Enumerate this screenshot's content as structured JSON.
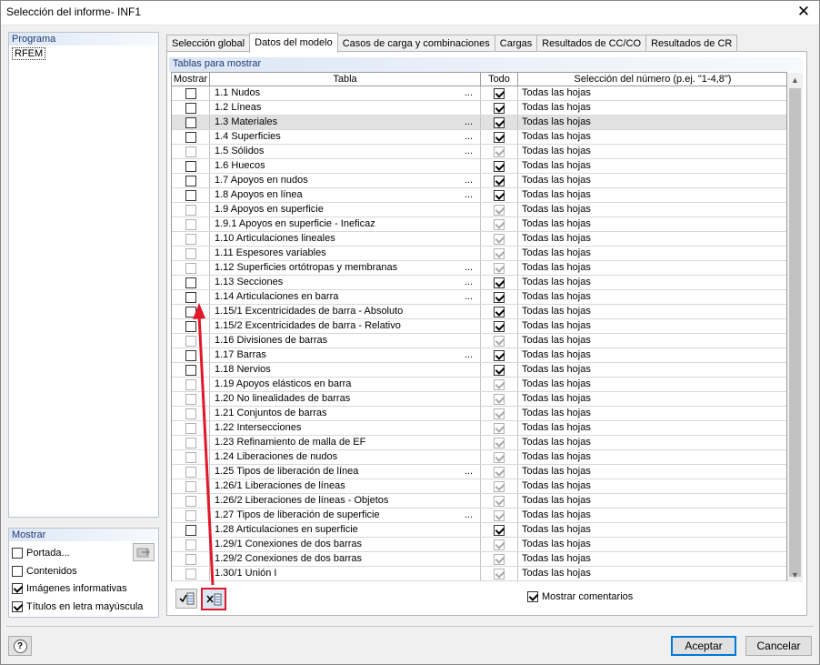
{
  "window": {
    "title": "Selección del informe- INF1",
    "close_glyph": "✕"
  },
  "programa": {
    "heading": "Programa",
    "item": "RFEM"
  },
  "mostrar": {
    "heading": "Mostrar",
    "options": [
      {
        "label": "Portada...",
        "checked": false
      },
      {
        "label": "Contenidos",
        "checked": false
      },
      {
        "label": "Imágenes informativas",
        "checked": true
      },
      {
        "label": "Títulos en letra mayúscula",
        "checked": true
      }
    ]
  },
  "tabs": [
    "Selección global",
    "Datos del modelo",
    "Casos de carga y combinaciones",
    "Cargas",
    "Resultados de CC/CO",
    "Resultados de CR"
  ],
  "active_tab": 1,
  "group": {
    "heading": "Tablas para mostrar"
  },
  "table": {
    "columns": [
      "Mostrar",
      "Tabla",
      "Todo",
      "Selección del número (p.ej. \"1-4,8\")"
    ],
    "rows": [
      {
        "name": "1.1 Nudos",
        "dots": true,
        "enabled": true,
        "selection": "Todas las hojas"
      },
      {
        "name": "1.2 Líneas",
        "dots": false,
        "enabled": true,
        "selection": "Todas las hojas"
      },
      {
        "name": "1.3 Materiales",
        "dots": true,
        "enabled": true,
        "selection": "Todas las hojas",
        "highlight": true
      },
      {
        "name": "1.4 Superficies",
        "dots": true,
        "enabled": true,
        "selection": "Todas las hojas"
      },
      {
        "name": "1.5 Sólidos",
        "dots": true,
        "enabled": false,
        "selection": "Todas las hojas"
      },
      {
        "name": "1.6 Huecos",
        "dots": false,
        "enabled": true,
        "selection": "Todas las hojas"
      },
      {
        "name": "1.7 Apoyos en nudos",
        "dots": true,
        "enabled": true,
        "selection": "Todas las hojas"
      },
      {
        "name": "1.8 Apoyos en línea",
        "dots": true,
        "enabled": true,
        "selection": "Todas las hojas"
      },
      {
        "name": "1.9 Apoyos en superficie",
        "dots": false,
        "enabled": false,
        "selection": "Todas las hojas"
      },
      {
        "name": "1.9.1 Apoyos en superficie - Ineficaz",
        "dots": false,
        "enabled": false,
        "selection": "Todas las hojas"
      },
      {
        "name": "1.10 Articulaciones lineales",
        "dots": false,
        "enabled": false,
        "selection": "Todas las hojas"
      },
      {
        "name": "1.11 Espesores variables",
        "dots": false,
        "enabled": false,
        "selection": "Todas las hojas"
      },
      {
        "name": "1.12 Superficies ortótropas y membranas",
        "dots": true,
        "enabled": false,
        "selection": "Todas las hojas"
      },
      {
        "name": "1.13 Secciones",
        "dots": true,
        "enabled": true,
        "selection": "Todas las hojas"
      },
      {
        "name": "1.14 Articulaciones en barra",
        "dots": true,
        "enabled": true,
        "selection": "Todas las hojas"
      },
      {
        "name": "1.15/1 Excentricidades de barra - Absoluto",
        "dots": false,
        "enabled": true,
        "selection": "Todas las hojas"
      },
      {
        "name": "1.15/2 Excentricidades de barra - Relativo",
        "dots": false,
        "enabled": true,
        "selection": "Todas las hojas"
      },
      {
        "name": "1.16 Divisiones de barras",
        "dots": false,
        "enabled": false,
        "selection": "Todas las hojas"
      },
      {
        "name": "1.17 Barras",
        "dots": true,
        "enabled": true,
        "selection": "Todas las hojas"
      },
      {
        "name": "1.18 Nervios",
        "dots": false,
        "enabled": true,
        "selection": "Todas las hojas"
      },
      {
        "name": "1.19 Apoyos elásticos en barra",
        "dots": false,
        "enabled": false,
        "selection": "Todas las hojas"
      },
      {
        "name": "1.20 No linealidades de barras",
        "dots": false,
        "enabled": false,
        "selection": "Todas las hojas"
      },
      {
        "name": "1.21 Conjuntos de barras",
        "dots": false,
        "enabled": false,
        "selection": "Todas las hojas"
      },
      {
        "name": "1.22 Intersecciones",
        "dots": false,
        "enabled": false,
        "selection": "Todas las hojas"
      },
      {
        "name": "1.23 Refinamiento de malla de EF",
        "dots": false,
        "enabled": false,
        "selection": "Todas las hojas"
      },
      {
        "name": "1.24 Liberaciones de nudos",
        "dots": false,
        "enabled": false,
        "selection": "Todas las hojas"
      },
      {
        "name": "1.25 Tipos de liberación de línea",
        "dots": true,
        "enabled": false,
        "selection": "Todas las hojas"
      },
      {
        "name": "1.26/1 Liberaciones de líneas",
        "dots": false,
        "enabled": false,
        "selection": "Todas las hojas"
      },
      {
        "name": "1.26/2 Liberaciones de líneas - Objetos",
        "dots": false,
        "enabled": false,
        "selection": "Todas las hojas"
      },
      {
        "name": "1.27 Tipos de liberación de superficie",
        "dots": true,
        "enabled": false,
        "selection": "Todas las hojas"
      },
      {
        "name": "1.28 Articulaciones en superficie",
        "dots": false,
        "enabled": true,
        "selection": "Todas las hojas"
      },
      {
        "name": "1.29/1 Conexiones de dos barras",
        "dots": false,
        "enabled": false,
        "selection": "Todas las hojas"
      },
      {
        "name": "1.29/2 Conexiones de dos barras",
        "dots": false,
        "enabled": false,
        "selection": "Todas las hojas"
      },
      {
        "name": "1.30/1 Unión I",
        "dots": false,
        "enabled": false,
        "selection": "Todas las hojas"
      }
    ]
  },
  "comments": {
    "label": "Mostrar comentarios",
    "checked": true
  },
  "buttons": {
    "accept": "Aceptar",
    "cancel": "Cancelar",
    "help_glyph": "?"
  },
  "dots_glyph": "...",
  "annotation_color": "#e0182a"
}
